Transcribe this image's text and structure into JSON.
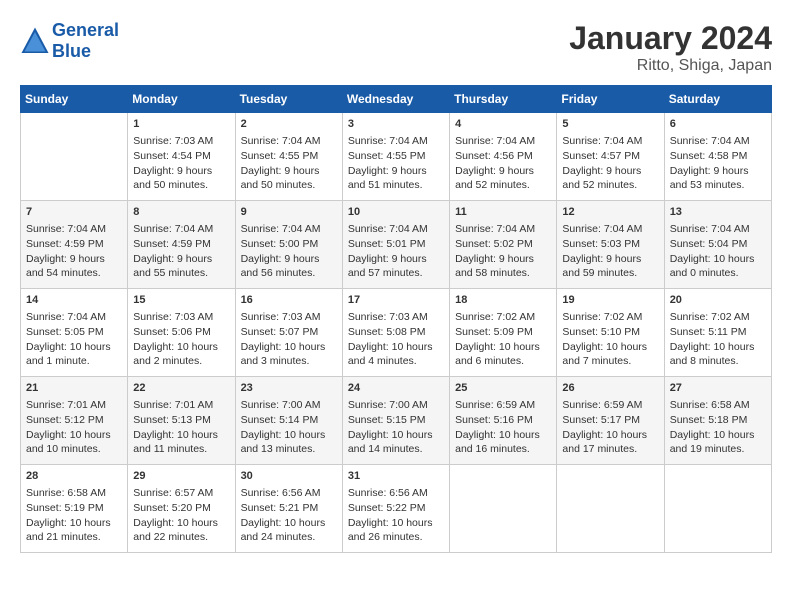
{
  "header": {
    "logo_line1": "General",
    "logo_line2": "Blue",
    "month_year": "January 2024",
    "location": "Ritto, Shiga, Japan"
  },
  "columns": [
    "Sunday",
    "Monday",
    "Tuesday",
    "Wednesday",
    "Thursday",
    "Friday",
    "Saturday"
  ],
  "weeks": [
    [
      {
        "day": "",
        "content": ""
      },
      {
        "day": "1",
        "content": "Sunrise: 7:03 AM\nSunset: 4:54 PM\nDaylight: 9 hours\nand 50 minutes."
      },
      {
        "day": "2",
        "content": "Sunrise: 7:04 AM\nSunset: 4:55 PM\nDaylight: 9 hours\nand 50 minutes."
      },
      {
        "day": "3",
        "content": "Sunrise: 7:04 AM\nSunset: 4:55 PM\nDaylight: 9 hours\nand 51 minutes."
      },
      {
        "day": "4",
        "content": "Sunrise: 7:04 AM\nSunset: 4:56 PM\nDaylight: 9 hours\nand 52 minutes."
      },
      {
        "day": "5",
        "content": "Sunrise: 7:04 AM\nSunset: 4:57 PM\nDaylight: 9 hours\nand 52 minutes."
      },
      {
        "day": "6",
        "content": "Sunrise: 7:04 AM\nSunset: 4:58 PM\nDaylight: 9 hours\nand 53 minutes."
      }
    ],
    [
      {
        "day": "7",
        "content": "Sunrise: 7:04 AM\nSunset: 4:59 PM\nDaylight: 9 hours\nand 54 minutes."
      },
      {
        "day": "8",
        "content": "Sunrise: 7:04 AM\nSunset: 4:59 PM\nDaylight: 9 hours\nand 55 minutes."
      },
      {
        "day": "9",
        "content": "Sunrise: 7:04 AM\nSunset: 5:00 PM\nDaylight: 9 hours\nand 56 minutes."
      },
      {
        "day": "10",
        "content": "Sunrise: 7:04 AM\nSunset: 5:01 PM\nDaylight: 9 hours\nand 57 minutes."
      },
      {
        "day": "11",
        "content": "Sunrise: 7:04 AM\nSunset: 5:02 PM\nDaylight: 9 hours\nand 58 minutes."
      },
      {
        "day": "12",
        "content": "Sunrise: 7:04 AM\nSunset: 5:03 PM\nDaylight: 9 hours\nand 59 minutes."
      },
      {
        "day": "13",
        "content": "Sunrise: 7:04 AM\nSunset: 5:04 PM\nDaylight: 10 hours\nand 0 minutes."
      }
    ],
    [
      {
        "day": "14",
        "content": "Sunrise: 7:04 AM\nSunset: 5:05 PM\nDaylight: 10 hours\nand 1 minute."
      },
      {
        "day": "15",
        "content": "Sunrise: 7:03 AM\nSunset: 5:06 PM\nDaylight: 10 hours\nand 2 minutes."
      },
      {
        "day": "16",
        "content": "Sunrise: 7:03 AM\nSunset: 5:07 PM\nDaylight: 10 hours\nand 3 minutes."
      },
      {
        "day": "17",
        "content": "Sunrise: 7:03 AM\nSunset: 5:08 PM\nDaylight: 10 hours\nand 4 minutes."
      },
      {
        "day": "18",
        "content": "Sunrise: 7:02 AM\nSunset: 5:09 PM\nDaylight: 10 hours\nand 6 minutes."
      },
      {
        "day": "19",
        "content": "Sunrise: 7:02 AM\nSunset: 5:10 PM\nDaylight: 10 hours\nand 7 minutes."
      },
      {
        "day": "20",
        "content": "Sunrise: 7:02 AM\nSunset: 5:11 PM\nDaylight: 10 hours\nand 8 minutes."
      }
    ],
    [
      {
        "day": "21",
        "content": "Sunrise: 7:01 AM\nSunset: 5:12 PM\nDaylight: 10 hours\nand 10 minutes."
      },
      {
        "day": "22",
        "content": "Sunrise: 7:01 AM\nSunset: 5:13 PM\nDaylight: 10 hours\nand 11 minutes."
      },
      {
        "day": "23",
        "content": "Sunrise: 7:00 AM\nSunset: 5:14 PM\nDaylight: 10 hours\nand 13 minutes."
      },
      {
        "day": "24",
        "content": "Sunrise: 7:00 AM\nSunset: 5:15 PM\nDaylight: 10 hours\nand 14 minutes."
      },
      {
        "day": "25",
        "content": "Sunrise: 6:59 AM\nSunset: 5:16 PM\nDaylight: 10 hours\nand 16 minutes."
      },
      {
        "day": "26",
        "content": "Sunrise: 6:59 AM\nSunset: 5:17 PM\nDaylight: 10 hours\nand 17 minutes."
      },
      {
        "day": "27",
        "content": "Sunrise: 6:58 AM\nSunset: 5:18 PM\nDaylight: 10 hours\nand 19 minutes."
      }
    ],
    [
      {
        "day": "28",
        "content": "Sunrise: 6:58 AM\nSunset: 5:19 PM\nDaylight: 10 hours\nand 21 minutes."
      },
      {
        "day": "29",
        "content": "Sunrise: 6:57 AM\nSunset: 5:20 PM\nDaylight: 10 hours\nand 22 minutes."
      },
      {
        "day": "30",
        "content": "Sunrise: 6:56 AM\nSunset: 5:21 PM\nDaylight: 10 hours\nand 24 minutes."
      },
      {
        "day": "31",
        "content": "Sunrise: 6:56 AM\nSunset: 5:22 PM\nDaylight: 10 hours\nand 26 minutes."
      },
      {
        "day": "",
        "content": ""
      },
      {
        "day": "",
        "content": ""
      },
      {
        "day": "",
        "content": ""
      }
    ]
  ]
}
